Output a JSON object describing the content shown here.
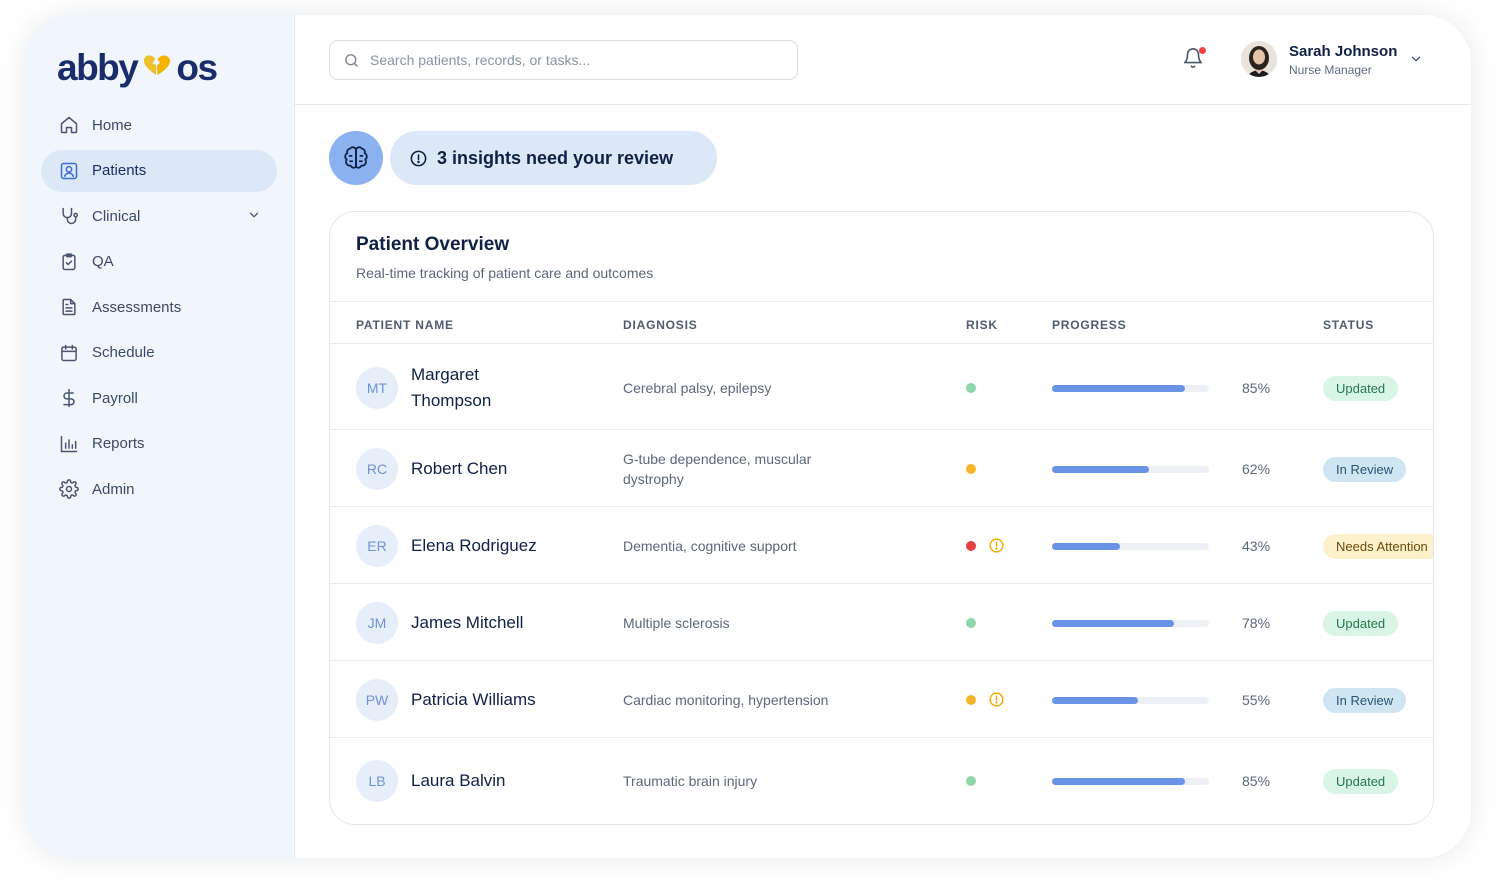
{
  "brand": {
    "logo_left": "abby",
    "logo_right": "os",
    "heart_colors": [
      "#f5b400",
      "#f0c12e"
    ]
  },
  "sidebar": {
    "items": [
      {
        "label": "Home",
        "icon": "home-icon"
      },
      {
        "label": "Patients",
        "icon": "user-square-icon",
        "active": true
      },
      {
        "label": "Clinical",
        "icon": "stethoscope-icon",
        "has_submenu": true
      },
      {
        "label": "QA",
        "icon": "clipboard-check-icon"
      },
      {
        "label": "Assessments",
        "icon": "document-icon"
      },
      {
        "label": "Schedule",
        "icon": "calendar-icon"
      },
      {
        "label": "Payroll",
        "icon": "dollar-icon"
      },
      {
        "label": "Reports",
        "icon": "bar-chart-icon"
      },
      {
        "label": "Admin",
        "icon": "gear-icon"
      }
    ]
  },
  "header": {
    "search_placeholder": "Search patients, records, or tasks...",
    "notifications_unread": true,
    "user": {
      "name": "Sarah Johnson",
      "role": "Nurse Manager"
    }
  },
  "insights": {
    "label": "3 insights need your review"
  },
  "overview": {
    "title": "Patient Overview",
    "subtitle": "Real-time tracking of patient care and outcomes",
    "columns": [
      "PATIENT NAME",
      "DIAGNOSIS",
      "RISK",
      "PROGRESS",
      "STATUS"
    ],
    "rows": [
      {
        "initials": "MT",
        "name": "Margaret Thompson",
        "diagnosis": "Cerebral palsy, epilepsy",
        "risk": "low",
        "risk_color": "#8fd6a8",
        "alert": false,
        "progress": 85,
        "progress_label": "85%",
        "status": "Updated",
        "status_type": "updated"
      },
      {
        "initials": "RC",
        "name": "Robert Chen",
        "diagnosis": "G-tube dependence, muscular dystrophy",
        "risk": "medium",
        "risk_color": "#f5b52a",
        "alert": false,
        "progress": 62,
        "progress_label": "62%",
        "status": "In Review",
        "status_type": "review"
      },
      {
        "initials": "ER",
        "name": "Elena Rodriguez",
        "diagnosis": "Dementia, cognitive support",
        "risk": "high",
        "risk_color": "#e53e3e",
        "alert": true,
        "progress": 43,
        "progress_label": "43%",
        "status": "Needs Attention",
        "status_type": "attention"
      },
      {
        "initials": "JM",
        "name": "James Mitchell",
        "diagnosis": "Multiple sclerosis",
        "risk": "low",
        "risk_color": "#8fd6a8",
        "alert": false,
        "progress": 78,
        "progress_label": "78%",
        "status": "Updated",
        "status_type": "updated"
      },
      {
        "initials": "PW",
        "name": "Patricia Williams",
        "diagnosis": "Cardiac monitoring, hypertension",
        "risk": "medium",
        "risk_color": "#f5b52a",
        "alert": true,
        "progress": 55,
        "progress_label": "55%",
        "status": "In Review",
        "status_type": "review"
      },
      {
        "initials": "LB",
        "name": "Laura Balvin",
        "diagnosis": "Traumatic brain injury",
        "risk": "low",
        "risk_color": "#8fd6a8",
        "alert": false,
        "progress": 85,
        "progress_label": "85%",
        "status": "Updated",
        "status_type": "updated"
      }
    ]
  },
  "colors": {
    "accent": "#6a92e6",
    "sidebar_bg": "#f1f6fd",
    "active_bg": "#dce7f7",
    "navy": "#0f2146"
  }
}
